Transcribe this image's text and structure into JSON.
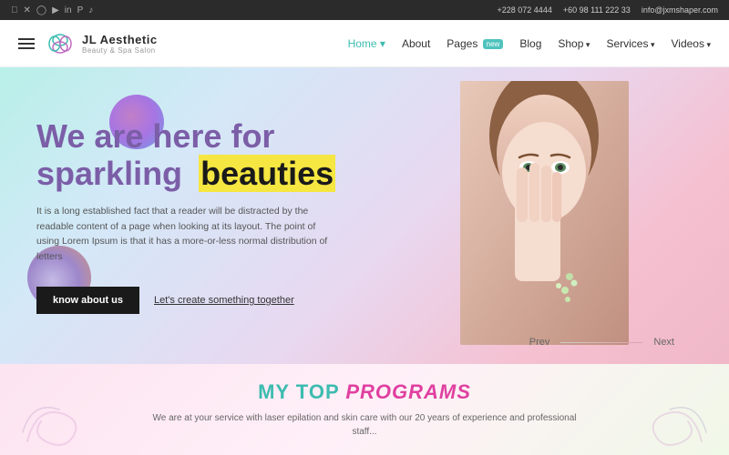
{
  "topbar": {
    "phone1": "+228 072 4444",
    "phone2": "+60 98 111 222 33",
    "email": "info@jxmshaper.com",
    "social_icons": [
      "facebook",
      "twitter",
      "instagram",
      "youtube",
      "linkedin",
      "pinterest",
      "tiktok"
    ]
  },
  "navbar": {
    "logo_title": "JL Aesthetic",
    "logo_subtitle": "Beauty & Spa Salon",
    "hamburger_label": "menu",
    "links": [
      {
        "label": "Home",
        "active": true,
        "has_dropdown": true
      },
      {
        "label": "About",
        "active": false,
        "has_dropdown": false
      },
      {
        "label": "Pages",
        "active": false,
        "has_dropdown": false,
        "badge": "new"
      },
      {
        "label": "Blog",
        "active": false,
        "has_dropdown": false
      },
      {
        "label": "Shop",
        "active": false,
        "has_dropdown": true
      },
      {
        "label": "Services",
        "active": false,
        "has_dropdown": true
      },
      {
        "label": "Videos",
        "active": false,
        "has_dropdown": true
      }
    ]
  },
  "hero": {
    "heading_line1": "We are here for",
    "heading_line2_plain": "sparkling",
    "heading_line2_bold": "beauties",
    "paragraph": "It is a long established fact that a reader will be distracted by the readable content of a page when looking at its layout. The point of using Lorem Ipsum is that it has a more-or-less normal distribution of letters",
    "btn_know": "know about us",
    "btn_link": "Let's create something together",
    "prev_label": "Prev",
    "next_label": "Next"
  },
  "bottom": {
    "title_my": "MY TOP",
    "title_programs": "PROGRAMS",
    "paragraph": "We are at your service with laser epilation and skin care with our 20 years of experience and professional staff..."
  },
  "colors": {
    "accent_teal": "#3dbcb0",
    "accent_purple": "#7b5ea7",
    "accent_pink": "#e040a0",
    "accent_yellow": "#f5e642",
    "dark": "#1a1a1a"
  }
}
